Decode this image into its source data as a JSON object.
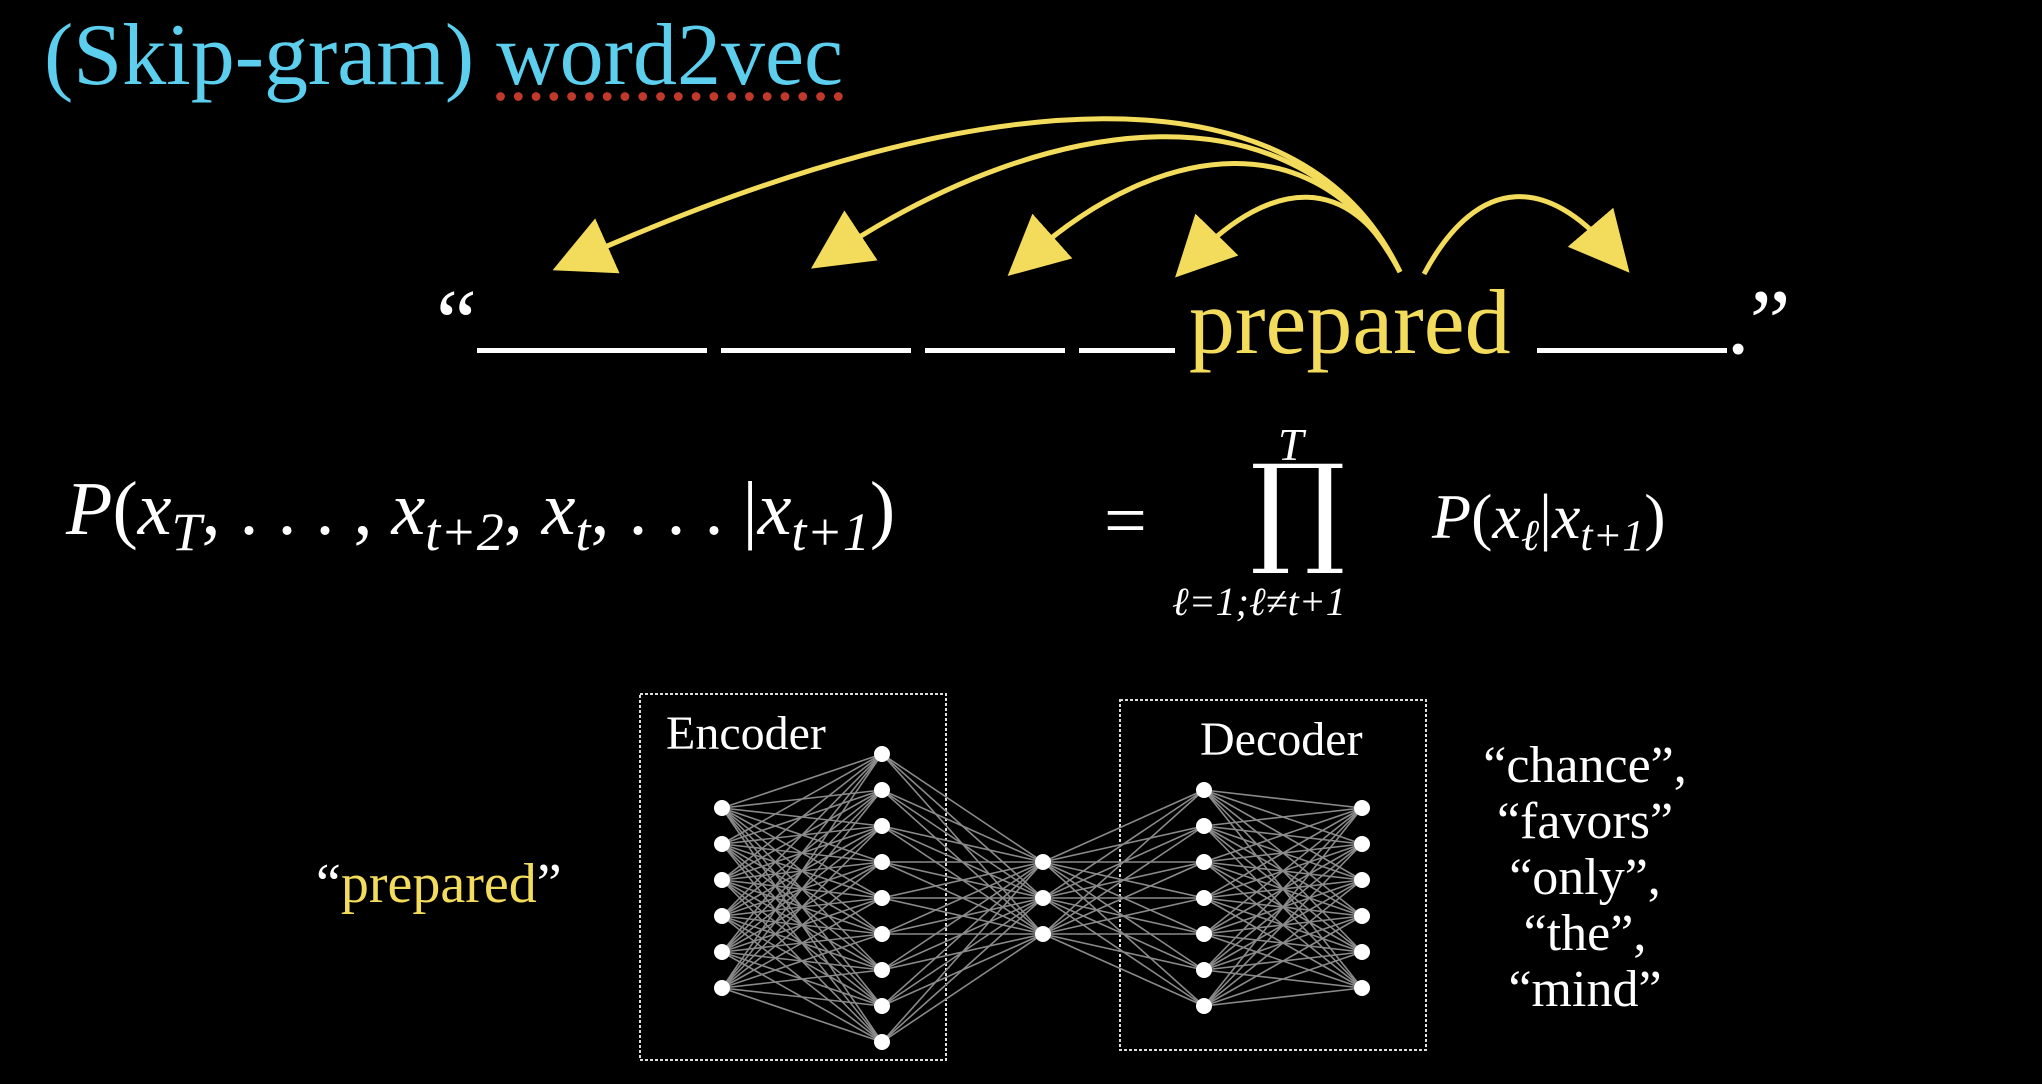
{
  "title": {
    "part1": "(Skip-gram) ",
    "part2": "word2vec"
  },
  "sentence": {
    "open_quote": "“",
    "target_word": "prepared",
    "close": ".”"
  },
  "equation": {
    "lhs_P": "P",
    "lhs_paren_open": "(",
    "lhs_x1": "x",
    "lhs_sub1": "T",
    "lhs_sep1": ", . . . , ",
    "lhs_x2": "x",
    "lhs_sub2": "t+2",
    "lhs_sep2": ", ",
    "lhs_x3": "x",
    "lhs_sub3": "t",
    "lhs_sep3": ", . . . |",
    "lhs_x4": "x",
    "lhs_sub4": "t+1",
    "lhs_paren_close": ")",
    "equals": "=",
    "product_symbol": "∏",
    "product_upper": "T",
    "product_lower": "ℓ=1;ℓ≠t+1",
    "rhs_P": "P",
    "rhs_open": "(",
    "rhs_x1": "x",
    "rhs_sub1": "ℓ",
    "rhs_bar": "|",
    "rhs_x2": "x",
    "rhs_sub2": "t+1",
    "rhs_close": ")"
  },
  "network": {
    "encoder_label": "Encoder",
    "decoder_label": "Decoder",
    "input": {
      "open_quote": "“",
      "word": "prepared",
      "close_quote": "”"
    },
    "outputs": [
      "“chance”,",
      "“favors”",
      "“only”,",
      "“the”,",
      "“mind”"
    ]
  },
  "colors": {
    "title": "#5ccfee",
    "highlight": "#f3dc5c",
    "arrow": "#f3dc5c",
    "background": "#000000",
    "text": "#ffffff"
  }
}
